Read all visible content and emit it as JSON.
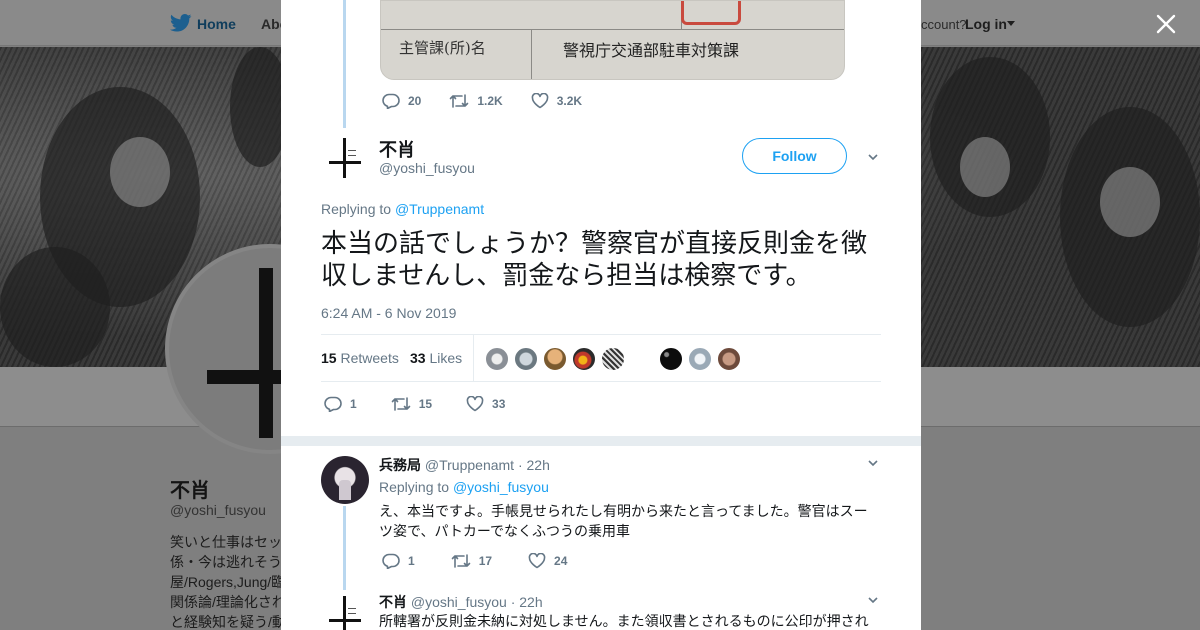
{
  "background": {
    "nav": {
      "home": "Home",
      "about": "Abo",
      "account": "ccount?",
      "login": "Log in"
    },
    "profile": {
      "name": "不肖",
      "handle": "@yoshi_fusyou",
      "bio_lines": [
        "笑いと仕事はセッ",
        "係・今は逃れそう",
        "屋/Rogers,Jung/臨",
        "関係論/理論化され",
        "と経験知を疑う/動"
      ]
    }
  },
  "modal": {
    "quoted_photo": {
      "label": "主管課(所)名",
      "value": "警視庁交通部駐車対策課"
    },
    "prev_actions": {
      "replies": "20",
      "retweets": "1.2K",
      "likes": "3.2K"
    },
    "main_tweet": {
      "name": "不肖",
      "handle": "@yoshi_fusyou",
      "follow_label": "Follow",
      "replying_prefix": "Replying to",
      "replying_to": "@Truppenamt",
      "text": "本当の話でしょうか？警察官が直接反則金を徴収しませんし、罰金なら担当は検察です。",
      "timestamp": "6:24 AM - 6 Nov 2019",
      "retweets_count": "15",
      "retweets_label": "Retweets",
      "likes_count": "33",
      "likes_label": "Likes",
      "actions": {
        "replies": "1",
        "retweets": "15",
        "likes": "33"
      }
    },
    "replies": [
      {
        "name": "兵務局",
        "handle": "@Truppenamt",
        "time": "· 22h",
        "replying_prefix": "Replying to",
        "replying_to": "@yoshi_fusyou",
        "text": "え、本当ですよ。手帳見せられたし有明から来たと言ってました。警官はスーツ姿で、パトカーでなくふつうの乗用車",
        "actions": {
          "replies": "1",
          "retweets": "17",
          "likes": "24"
        }
      },
      {
        "name": "不肖",
        "handle": "@yoshi_fusyou",
        "time": "· 22h",
        "text": "所轄署が反則金未納に対処しません。また領収書とされるものに公印が押され"
      }
    ]
  },
  "colors": {
    "accent": "#1da1f2",
    "muted": "#657786",
    "text": "#14171a",
    "thread": "#b9d7ef"
  },
  "icons": [
    "twitter-bird-icon",
    "close-icon",
    "reply-icon",
    "retweet-icon",
    "like-icon",
    "chevron-down-icon"
  ]
}
